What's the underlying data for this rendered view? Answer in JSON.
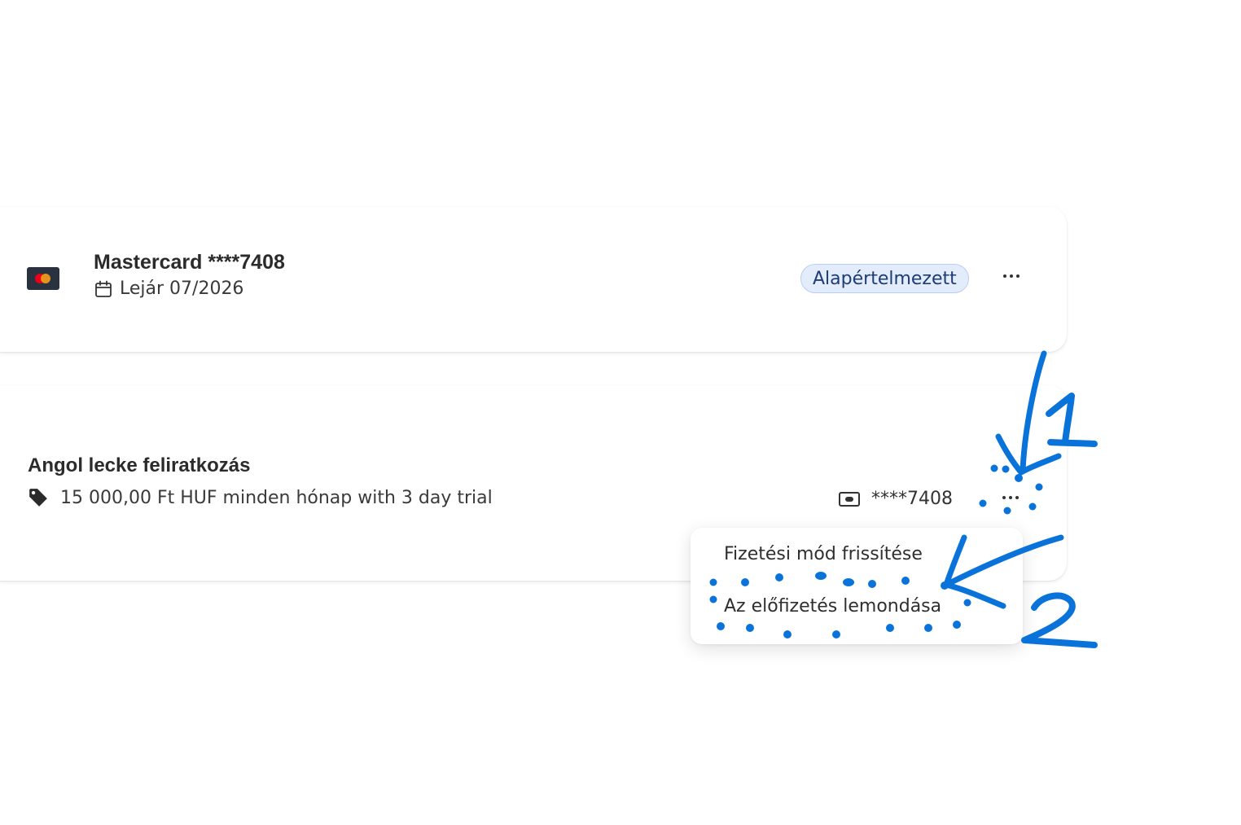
{
  "payment_method": {
    "card_label": "Mastercard ****7408",
    "card_icon": "mastercard-icon",
    "expiry_icon": "calendar-icon",
    "expiry": "Lejár 07/2026",
    "default_badge": "Alapértelmezett",
    "more_icon": "more-horizontal-icon"
  },
  "subscription": {
    "title": "Angol lecke feliratkozás",
    "price_icon": "tag-icon",
    "price": "15 000,00 Ft HUF minden hónap with 3 day trial",
    "card_icon": "credit-card-icon",
    "card_ref": "****7408",
    "more_icon": "more-horizontal-icon"
  },
  "dropdown_menu": {
    "items": [
      "Fizetési mód frissítése",
      "Az előfizetés lemondása"
    ]
  },
  "annotations": {
    "labels": [
      "1",
      "2"
    ],
    "color": "#0a73d9"
  }
}
